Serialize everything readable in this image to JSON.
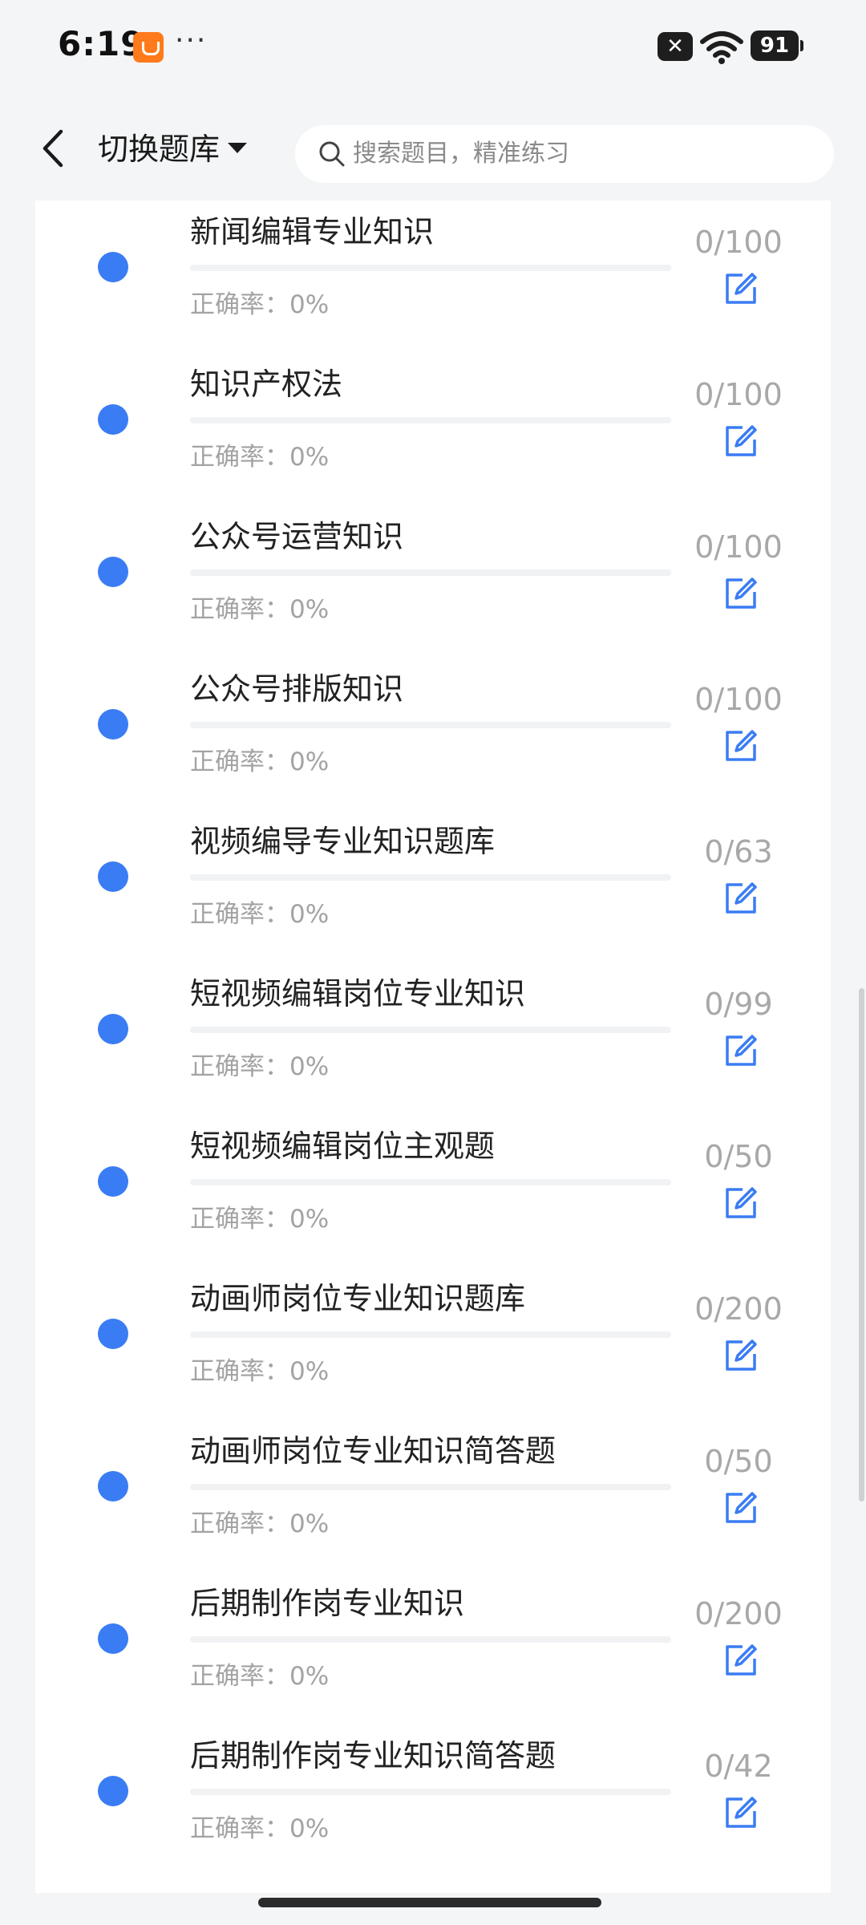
{
  "status_bar": {
    "time": "6:19",
    "more": "···",
    "x_badge": "✕",
    "battery": "91"
  },
  "header": {
    "switch_label": "切换题库",
    "search_placeholder": "搜索题目，精准练习"
  },
  "colors": {
    "accent": "#3a7cf4",
    "muted_text": "#a3a3a3",
    "progress_track": "#f1f2f4"
  },
  "icons": {
    "back": "chevron-left-icon",
    "dropdown": "caret-down-icon",
    "search": "search-icon",
    "edit": "edit-icon",
    "wifi": "wifi-icon",
    "app": "taobao-app-icon"
  },
  "list": {
    "items": [
      {
        "title": "新闻编辑专业知识",
        "accuracy": "正确率：0%",
        "count": "0/100",
        "progress": 0
      },
      {
        "title": "知识产权法",
        "accuracy": "正确率：0%",
        "count": "0/100",
        "progress": 0
      },
      {
        "title": "公众号运营知识",
        "accuracy": "正确率：0%",
        "count": "0/100",
        "progress": 0
      },
      {
        "title": "公众号排版知识",
        "accuracy": "正确率：0%",
        "count": "0/100",
        "progress": 0
      },
      {
        "title": "视频编导专业知识题库",
        "accuracy": "正确率：0%",
        "count": "0/63",
        "progress": 0
      },
      {
        "title": "短视频编辑岗位专业知识",
        "accuracy": "正确率：0%",
        "count": "0/99",
        "progress": 0
      },
      {
        "title": "短视频编辑岗位主观题",
        "accuracy": "正确率：0%",
        "count": "0/50",
        "progress": 0
      },
      {
        "title": "动画师岗位专业知识题库",
        "accuracy": "正确率：0%",
        "count": "0/200",
        "progress": 0
      },
      {
        "title": "动画师岗位专业知识简答题",
        "accuracy": "正确率：0%",
        "count": "0/50",
        "progress": 0
      },
      {
        "title": "后期制作岗专业知识",
        "accuracy": "正确率：0%",
        "count": "0/200",
        "progress": 0
      },
      {
        "title": "后期制作岗专业知识简答题",
        "accuracy": "正确率：0%",
        "count": "0/42",
        "progress": 0
      }
    ]
  }
}
